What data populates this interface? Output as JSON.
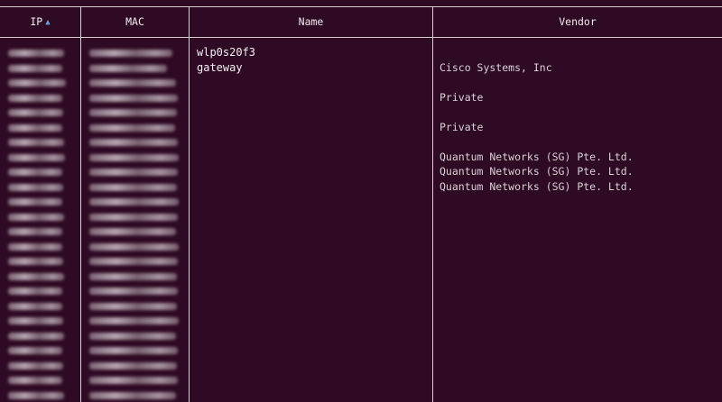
{
  "columns": {
    "ip": "IP",
    "ip_sort": "▲",
    "mac": "MAC",
    "name": "Name",
    "vendor": "Vendor"
  },
  "rows": [
    {
      "name": "wlp0s20f3",
      "vendor": ""
    },
    {
      "name": "gateway",
      "vendor": "Cisco Systems, Inc"
    },
    {
      "name": "",
      "vendor": ""
    },
    {
      "name": "",
      "vendor": "Private"
    },
    {
      "name": "",
      "vendor": ""
    },
    {
      "name": "",
      "vendor": "Private"
    },
    {
      "name": "",
      "vendor": ""
    },
    {
      "name": "",
      "vendor": "Quantum Networks (SG) Pte. Ltd."
    },
    {
      "name": "",
      "vendor": "Quantum Networks (SG) Pte. Ltd."
    },
    {
      "name": "",
      "vendor": "Quantum Networks (SG) Pte. Ltd."
    },
    {
      "name": "",
      "vendor": ""
    },
    {
      "name": "",
      "vendor": ""
    },
    {
      "name": "",
      "vendor": ""
    },
    {
      "name": "",
      "vendor": ""
    },
    {
      "name": "",
      "vendor": ""
    },
    {
      "name": "",
      "vendor": ""
    },
    {
      "name": "",
      "vendor": ""
    },
    {
      "name": "",
      "vendor": ""
    },
    {
      "name": "",
      "vendor": ""
    },
    {
      "name": "",
      "vendor": ""
    },
    {
      "name": "",
      "vendor": ""
    },
    {
      "name": "",
      "vendor": ""
    },
    {
      "name": "",
      "vendor": ""
    },
    {
      "name": "",
      "vendor": ""
    }
  ]
}
